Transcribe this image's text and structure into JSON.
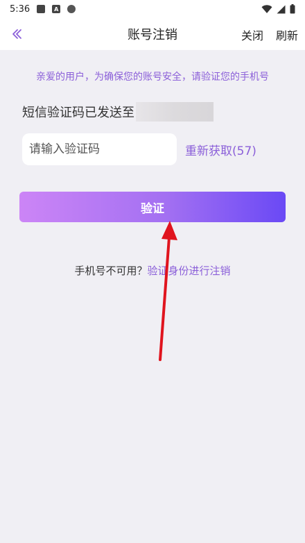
{
  "status_bar": {
    "time": "5:36",
    "icons": [
      "app-square-icon",
      "a-badge-icon",
      "shield-icon",
      "wifi-icon",
      "signal-icon",
      "battery-icon"
    ]
  },
  "header": {
    "title": "账号注销",
    "close_label": "关闭",
    "refresh_label": "刷新"
  },
  "notice": "亲爱的用户，为确保您的账号安全，请验证您的手机号",
  "sms": {
    "sent_label": "短信验证码已发送至"
  },
  "code_input": {
    "placeholder": "请输入验证码",
    "value": ""
  },
  "resend_label": "重新获取(57)",
  "verify_button": "验证",
  "alt": {
    "label": "手机号不可用？",
    "link": "验证身份进行注销"
  },
  "colors": {
    "accent": "#8b5fd9",
    "button_gradient_start": "#cc85f6",
    "button_gradient_end": "#6a49f5",
    "background": "#f0eff4",
    "arrow": "#e0141e"
  }
}
